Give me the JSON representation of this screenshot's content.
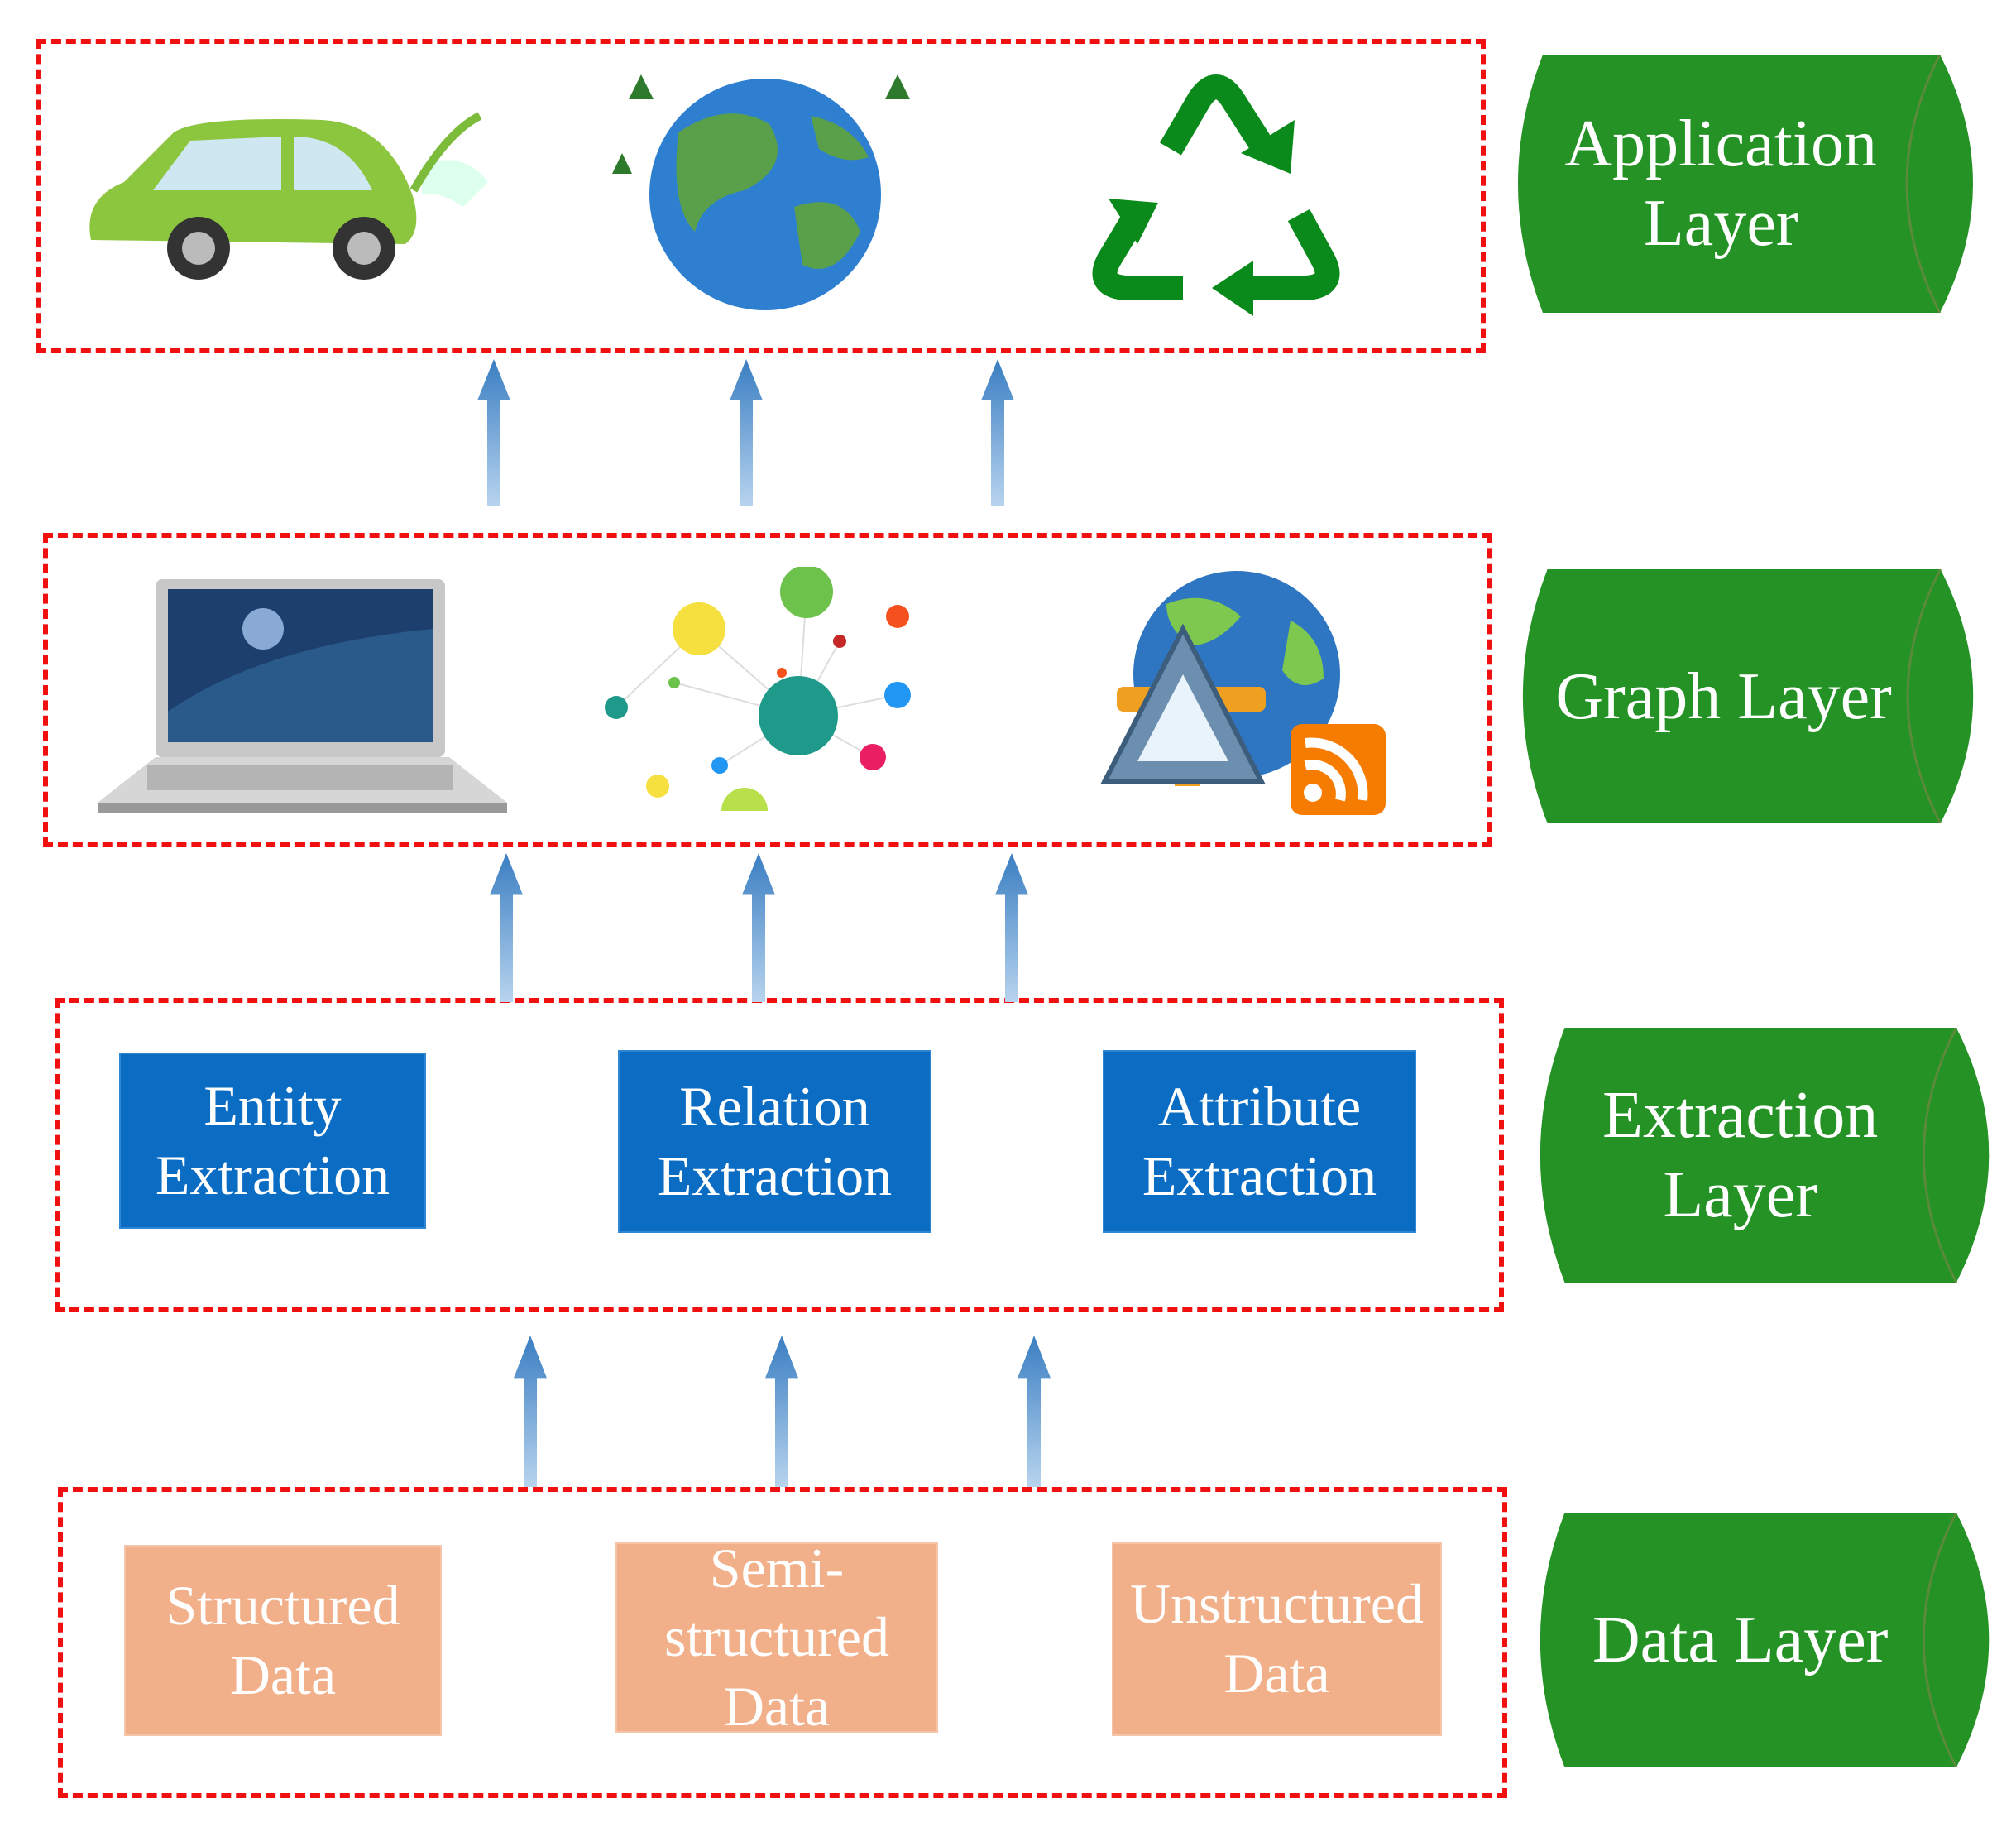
{
  "colors": {
    "dashed_border": "#f01010",
    "layer_label": "#259225",
    "extraction_box": "#0a6cc2",
    "data_box": "#f2b08a",
    "arrow": "#3a7ec2"
  },
  "layers": [
    {
      "label": "Application Layer",
      "icons": [
        "electric-car-icon",
        "earth-globe-icon",
        "recycle-icon"
      ]
    },
    {
      "label": "Graph Layer",
      "icons": [
        "laptop-icon",
        "network-graph-icon",
        "globe-rss-icon"
      ]
    },
    {
      "label": "Extraction Layer",
      "boxes": [
        "Entity Extraction",
        "Relation Extraction",
        "Attribute Extraction"
      ]
    },
    {
      "label": "Data Layer",
      "boxes": [
        "Structured Data",
        "Semi-structured Data",
        "Unstructured Data"
      ]
    }
  ]
}
